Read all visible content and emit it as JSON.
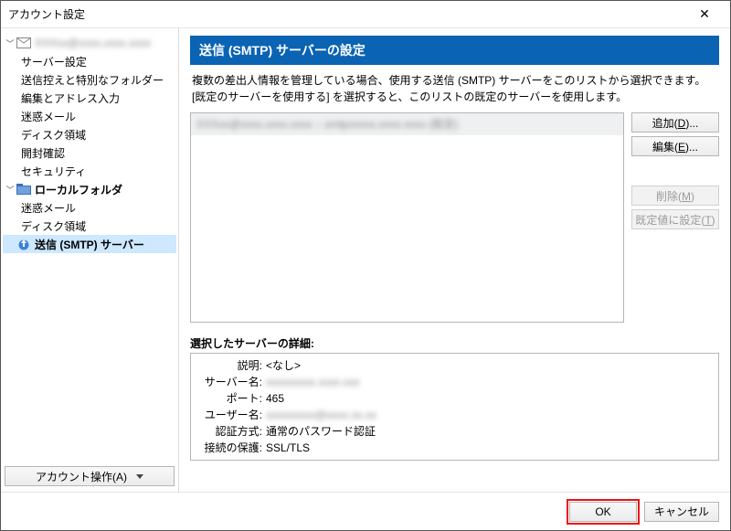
{
  "window": {
    "title": "アカウント設定",
    "close_glyph": "✕"
  },
  "sidebar": {
    "account_blur": "XXXxx@xxxx.xxxx.xxxx",
    "items_account": [
      "サーバー設定",
      "送信控えと特別なフォルダー",
      "編集とアドレス入力",
      "迷惑メール",
      "ディスク領域",
      "開封確認",
      "セキュリティ"
    ],
    "local_label": "ローカルフォルダ",
    "items_local": [
      "迷惑メール",
      "ディスク領域"
    ],
    "smtp_label": "送信 (SMTP) サーバー",
    "account_ops": "アカウント操作(A)"
  },
  "panel": {
    "header": "送信 (SMTP) サーバーの設定",
    "description": "複数の差出人情報を管理している場合、使用する送信 (SMTP) サーバーをこのリストから選択できます。[既定のサーバーを使用する] を選択すると、このリストの既定のサーバーを使用します。",
    "server_item_blur": "XXXxx@xxxx.xxxx.xxxx – smtpxxxxx.xxxx.xxxx (既定)",
    "buttons": {
      "add": {
        "pre": "追加(",
        "u": "D",
        "post": ")..."
      },
      "edit": {
        "pre": "編集(",
        "u": "E",
        "post": ")..."
      },
      "delete": {
        "pre": "削除(",
        "u": "M",
        "post": ")"
      },
      "default": {
        "pre": "既定値に設定(",
        "u": "T",
        "post": ")"
      }
    }
  },
  "details": {
    "title": "選択したサーバーの詳細:",
    "rows": {
      "desc_label": "説明:",
      "desc_val": "<なし>",
      "server_label": "サーバー名:",
      "server_val_blur": "xxxxxxxxx.xxxx.xxx",
      "port_label": "ポート:",
      "port_val": "465",
      "user_label": "ユーザー名:",
      "user_val_blur": "xxxxxxxxx@xxxx.xx.xx",
      "auth_label": "認証方式:",
      "auth_val": "通常のパスワード認証",
      "sec_label": "接続の保護:",
      "sec_val": "SSL/TLS"
    }
  },
  "footer": {
    "ok": "OK",
    "cancel": "キャンセル"
  }
}
